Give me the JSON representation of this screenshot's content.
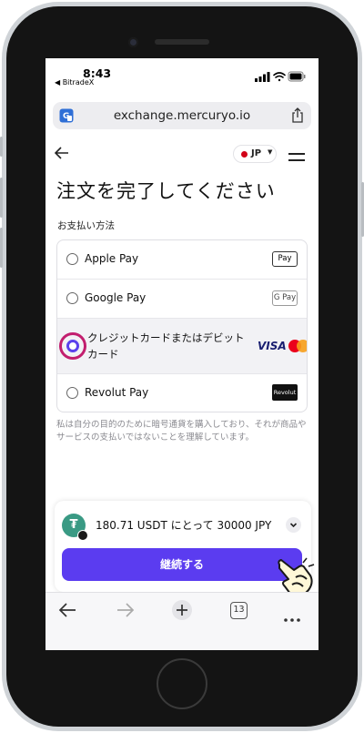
{
  "status_bar": {
    "time": "8:43",
    "back_app": "◀ BitradeX"
  },
  "browser": {
    "url": "exchange.mercuryo.io",
    "tab_count": "13"
  },
  "header": {
    "language": "JP",
    "language_color": "#d20018"
  },
  "page": {
    "title": "注文を完了してください",
    "section_label": "お支払い方法",
    "payment_methods": [
      {
        "label": "Apple Pay",
        "badge": "Pay",
        "selected": false
      },
      {
        "label": "Google Pay",
        "badge": "G Pay",
        "selected": false
      },
      {
        "label": "クレジットカードまたはデビットカード",
        "badge": "VISA",
        "selected": true
      },
      {
        "label": "Revolut Pay",
        "badge": "Revolut",
        "selected": false
      }
    ],
    "disclaimer": "私は自分の目的のために暗号通貨を購入しており、それが商品やサービスの支払いではないことを理解しています。"
  },
  "summary": {
    "text": "180.71 USDT にとって 30000 JPY",
    "continue_label": "継続する",
    "accent": "#5b3cf0"
  },
  "icons": [
    "translate-icon",
    "share-icon",
    "back-arrow-icon",
    "hamburger-menu-icon",
    "tether-icon",
    "chevron-down-icon",
    "pointing-hand-icon",
    "browser-back-icon",
    "browser-forward-icon",
    "new-tab-icon",
    "more-icon"
  ]
}
